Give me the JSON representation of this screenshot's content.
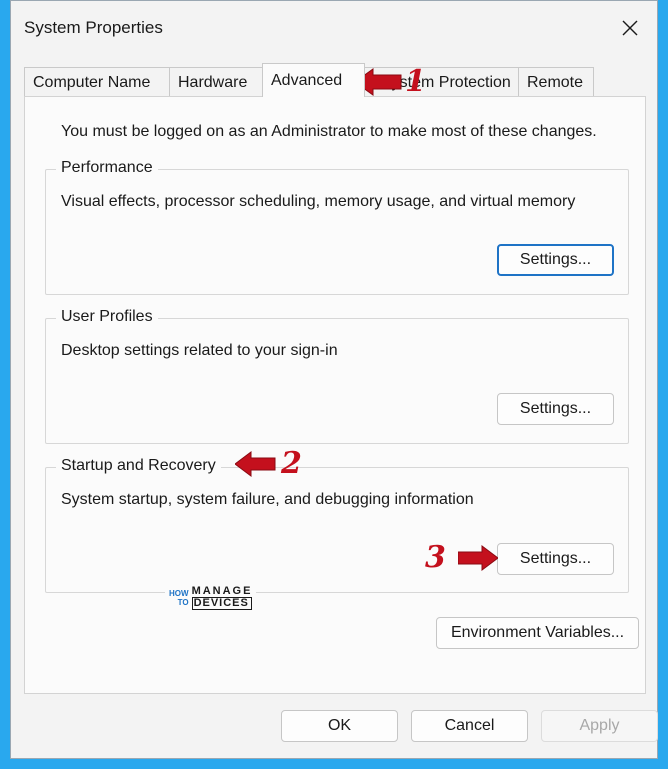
{
  "window": {
    "title": "System Properties"
  },
  "tabs": [
    {
      "label": "Computer Name"
    },
    {
      "label": "Hardware"
    },
    {
      "label": "Advanced"
    },
    {
      "label": "System Protection"
    },
    {
      "label": "Remote"
    }
  ],
  "advanced": {
    "admin_note": "You must be logged on as an Administrator to make most of these changes.",
    "performance": {
      "legend": "Performance",
      "description": "Visual effects, processor scheduling, memory usage, and virtual memory",
      "button": "Settings..."
    },
    "user_profiles": {
      "legend": "User Profiles",
      "description": "Desktop settings related to your sign-in",
      "button": "Settings..."
    },
    "startup_recovery": {
      "legend": "Startup and Recovery",
      "description": "System startup, system failure, and debugging information",
      "button": "Settings..."
    },
    "env_button": "Environment Variables..."
  },
  "footer": {
    "ok": "OK",
    "cancel": "Cancel",
    "apply": "Apply"
  },
  "annotations": {
    "step1": "1",
    "step2": "2",
    "step3": "3",
    "arrow_color": "#c4101d"
  },
  "logo": {
    "line1": "HOW",
    "line2": "TO",
    "big1": "MANAGE",
    "big2": "DEVICES"
  },
  "colors": {
    "background": "#29a8ee",
    "focus_border": "#1e73c6"
  }
}
